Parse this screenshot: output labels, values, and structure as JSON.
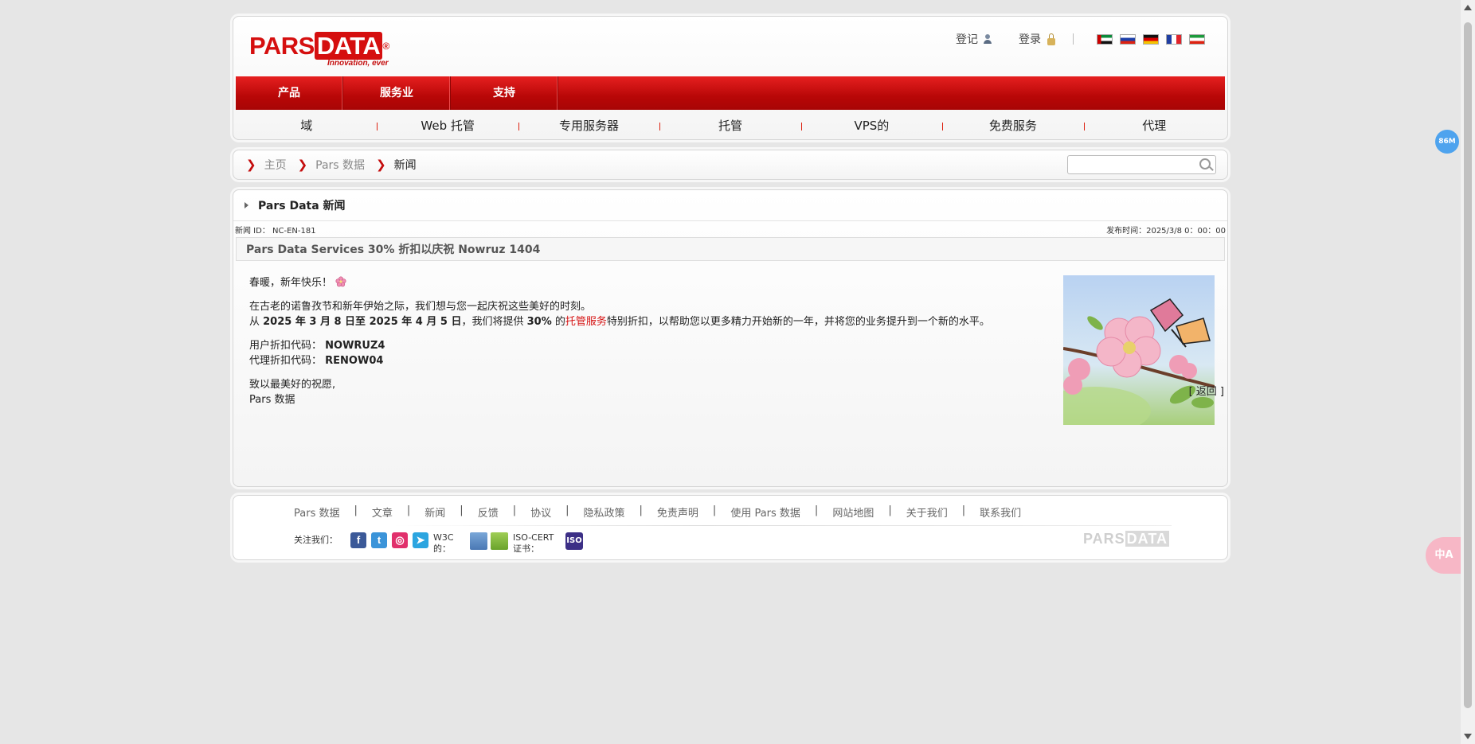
{
  "header": {
    "logo": {
      "pars": "PARS",
      "data": "DATA",
      "reg": "®",
      "tagline": "Innovation, ever"
    },
    "register_label": "登记",
    "login_label": "登录",
    "flags": [
      "flag-uae-icon",
      "flag-russia-icon",
      "flag-germany-icon",
      "flag-france-icon",
      "flag-iran-icon"
    ]
  },
  "main_menu": [
    "产品",
    "服务业",
    "支持"
  ],
  "sub_menu": [
    "域",
    "Web 托管",
    "专用服务器",
    "托管",
    "VPS的",
    "免费服务",
    "代理"
  ],
  "breadcrumb": {
    "home": "主页",
    "parent": "Pars 数据",
    "current": "新闻"
  },
  "search": {
    "placeholder": ""
  },
  "news": {
    "section_title": "Pars Data 新闻",
    "id_label": "新闻 ID： NC-EN-181",
    "published_label": "发布时间：2025/3/8 0：00：00",
    "headline": "Pars Data Services 30% 折扣以庆祝 Nowruz 1404",
    "greeting": "春暖，新年快乐！",
    "para1": "在古老的诺鲁孜节和新年伊始之际，我们想与您一起庆祝这些美好的时刻。",
    "para2_prefix": "从 ",
    "para2_dates": "2025 年 3 月 8 日至 2025 年 4 月 5 日",
    "para2_mid": "，我们将提供 ",
    "para2_percent": "30%",
    "para2_de": " 的",
    "para2_link": "托管服务",
    "para2_suffix": "特别折扣，以帮助您以更多精力开始新的一年，并将您的业务提升到一个新的水平。",
    "user_code_label": "用户折扣代码：",
    "user_code": "NOWRUZ4",
    "agent_code_label": "代理折扣代码：",
    "agent_code": "RENOW04",
    "closing": "致以最美好的祝愿,",
    "signature": "Pars 数据",
    "back_label": "[ 返回 ]"
  },
  "footer": {
    "links": [
      "Pars 数据",
      "文章",
      "新闻",
      "反馈",
      "协议",
      "隐私政策",
      "免责声明",
      "使用 Pars 数据",
      "网站地图",
      "关于我们",
      "联系我们"
    ],
    "separator": "|",
    "follow_label": "关注我们：",
    "w3c_label": "W3C 的：",
    "iso_label": "ISO-CERT 证书：",
    "logo_pars": "PARS",
    "logo_data": "DATA"
  },
  "widgets": {
    "memory": "86M",
    "translate": "中A"
  },
  "colors": {
    "brand_red": "#d50f0f",
    "menu_red": "#c40d0d",
    "background": "#e6e6e6"
  }
}
